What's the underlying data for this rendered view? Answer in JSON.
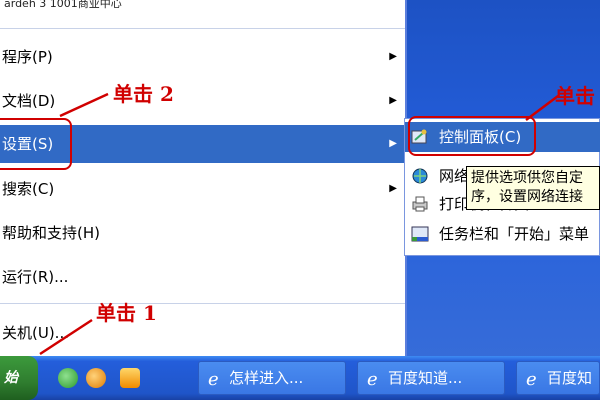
{
  "start_menu": {
    "top_text": "ardeh 3 1001商业中心",
    "items": [
      {
        "label": "程序(P)",
        "has_arrow": true
      },
      {
        "label": "文档(D)",
        "has_arrow": true
      },
      {
        "label": "设置(S)",
        "has_arrow": true,
        "highlighted": true
      },
      {
        "label": "搜索(C)",
        "has_arrow": true
      },
      {
        "label": "帮助和支持(H)",
        "has_arrow": false
      },
      {
        "label": "运行(R)...",
        "has_arrow": false
      },
      {
        "label": "关机(U)...",
        "has_arrow": false
      }
    ]
  },
  "submenu": {
    "items": [
      {
        "label": "控制面板(C)",
        "icon": "control-panel-icon",
        "highlighted": true
      },
      {
        "label": "网络连接(N)",
        "icon": "network-icon"
      },
      {
        "label": "打印机和传真",
        "icon": "printer-icon"
      },
      {
        "label": "任务栏和「开始」菜单",
        "icon": "taskbar-icon"
      }
    ]
  },
  "tooltip": {
    "line1": "提供选项供您自定",
    "line2": "序，设置网络连接"
  },
  "annotations": {
    "click1": "单击 1",
    "click2": "单击 2",
    "click3": "单击"
  },
  "taskbar": {
    "start_label": "始",
    "buttons": [
      {
        "label": "怎样进入..."
      },
      {
        "label": "百度知道..."
      },
      {
        "label": "百度知"
      }
    ]
  },
  "colors": {
    "highlight": "#316ac5",
    "annotation": "#d00000",
    "taskbar": "#245edb"
  }
}
